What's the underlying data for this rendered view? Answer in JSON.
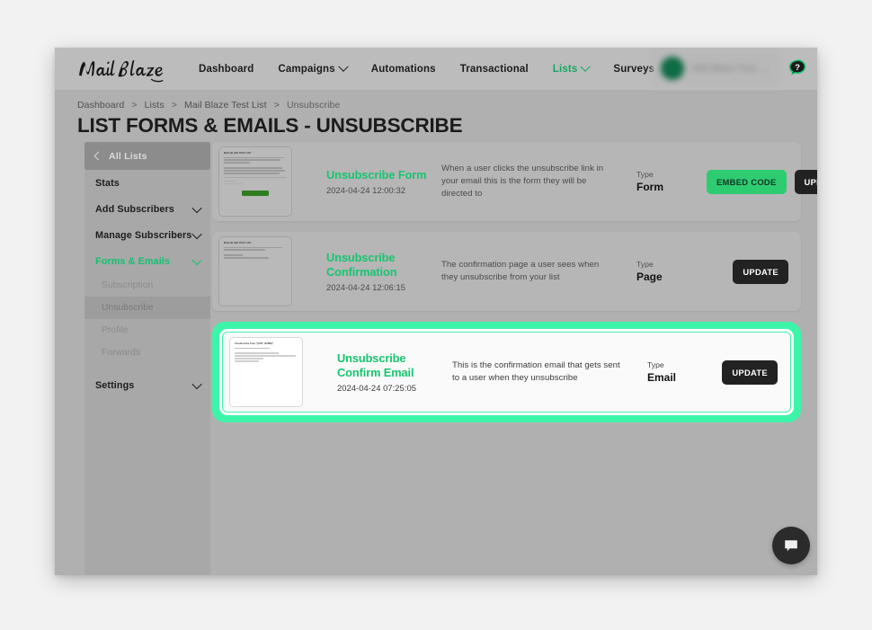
{
  "brand": {
    "logo_text": "MailBlaze",
    "accent_green": "#16c56f",
    "button_green": "#2ecc71",
    "highlight_green": "#3df5a8"
  },
  "topnav": {
    "links": [
      {
        "label": "Dashboard",
        "active": false,
        "caret": false
      },
      {
        "label": "Campaigns",
        "active": false,
        "caret": true
      },
      {
        "label": "Automations",
        "active": false,
        "caret": false
      },
      {
        "label": "Transactional",
        "active": false,
        "caret": false
      },
      {
        "label": "Lists",
        "active": true,
        "caret": true
      },
      {
        "label": "Surveys",
        "active": false,
        "caret": false
      }
    ],
    "user_name": "Mail Blaze Test",
    "help_icon": "help-question-bubble-icon"
  },
  "breadcrumb": {
    "items": [
      "Dashboard",
      "Lists",
      "Mail Blaze Test List",
      "Unsubscribe"
    ],
    "separator": ">"
  },
  "page": {
    "title": "LIST FORMS & EMAILS - UNSUBSCRIBE"
  },
  "sidebar": {
    "back_label": "All Lists",
    "items": [
      {
        "label": "Stats",
        "caret": false,
        "active": false
      },
      {
        "label": "Add Subscribers",
        "caret": true,
        "active": false
      },
      {
        "label": "Manage Subscribers",
        "caret": true,
        "active": false
      },
      {
        "label": "Forms & Emails",
        "caret": true,
        "active": true
      }
    ],
    "sub_items": [
      {
        "label": "Subscription",
        "selected": false
      },
      {
        "label": "Unsubscribe",
        "selected": true
      },
      {
        "label": "Profile",
        "selected": false
      },
      {
        "label": "Forwards",
        "selected": false
      }
    ],
    "footer_items": [
      {
        "label": "Settings",
        "caret": true,
        "active": false
      }
    ]
  },
  "cards": [
    {
      "name": "Unsubscribe Form",
      "date": "2024-04-24 12:00:32",
      "description": "When a user clicks the unsubscribe link in your email this is the form they will be directed to",
      "type_label": "Type",
      "type_value": "Form",
      "buttons": [
        {
          "label": "EMBED CODE",
          "style": "embed"
        },
        {
          "label": "UPDATE",
          "style": "update"
        }
      ],
      "highlighted": false,
      "thumb": {
        "title": "MAIL BLAZE TEST LIST",
        "lines": 6,
        "has_button": true,
        "has_fields": true
      }
    },
    {
      "name": "Unsubscribe Confirmation",
      "date": "2024-04-24 12:06:15",
      "description": "The confirmation page a user sees when they unsubscribe from your list",
      "type_label": "Type",
      "type_value": "Page",
      "buttons": [
        {
          "label": "UPDATE",
          "style": "update"
        }
      ],
      "highlighted": false,
      "thumb": {
        "title": "MAIL BLAZE TEST LIST",
        "lines": 4,
        "has_button": false,
        "has_fields": false
      }
    },
    {
      "name": "Unsubscribe Confirm Email",
      "date": "2024-04-24 07:25:05",
      "description": "This is the confirmation email that gets sent to a user when they unsubscribe",
      "type_label": "Type",
      "type_value": "Email",
      "buttons": [
        {
          "label": "UPDATE",
          "style": "update"
        }
      ],
      "highlighted": true,
      "thumb": {
        "title": "Unsubscribe from \"[LIST_NAME]\"",
        "lines": 4,
        "has_button": false,
        "has_fields": false
      }
    }
  ],
  "chat": {
    "icon": "chat-bubble-icon"
  }
}
